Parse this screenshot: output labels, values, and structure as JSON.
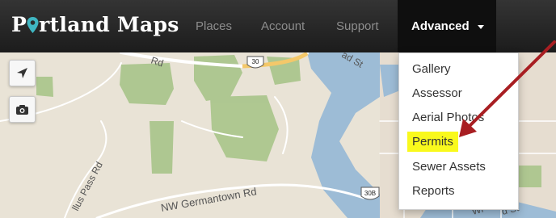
{
  "brand": {
    "prefix": "P",
    "suffix": "rtland Maps"
  },
  "nav": {
    "places": "Places",
    "account": "Account",
    "support": "Support",
    "advanced": "Advanced"
  },
  "dropdown": {
    "items": [
      "Gallery",
      "Assessor",
      "Aerial Photos",
      "Permits",
      "Sewer Assets",
      "Reports"
    ]
  },
  "map": {
    "labels": {
      "rd_top": "Rd",
      "hwy_30": "30",
      "road_right": "ad St",
      "pass_rd": "llus Pass Rd",
      "germantown": "NW Germantown Rd",
      "shield_30b": "30B",
      "bottom_right": "Wi",
      "bottom_st": "d St"
    }
  },
  "colors": {
    "navbar": "#2b2b2b",
    "active_nav": "#0f0f0f",
    "highlight": "#f9f91d",
    "pin": "#3fb6c2",
    "arrow": "#a81e22",
    "river": "#9dbcd6",
    "park": "#a8c48a",
    "land": "#e9e3d6"
  },
  "icons": [
    "navigate-arrow-icon",
    "camera-icon",
    "map-pin-icon",
    "chevron-down-icon",
    "annotation-arrow"
  ]
}
